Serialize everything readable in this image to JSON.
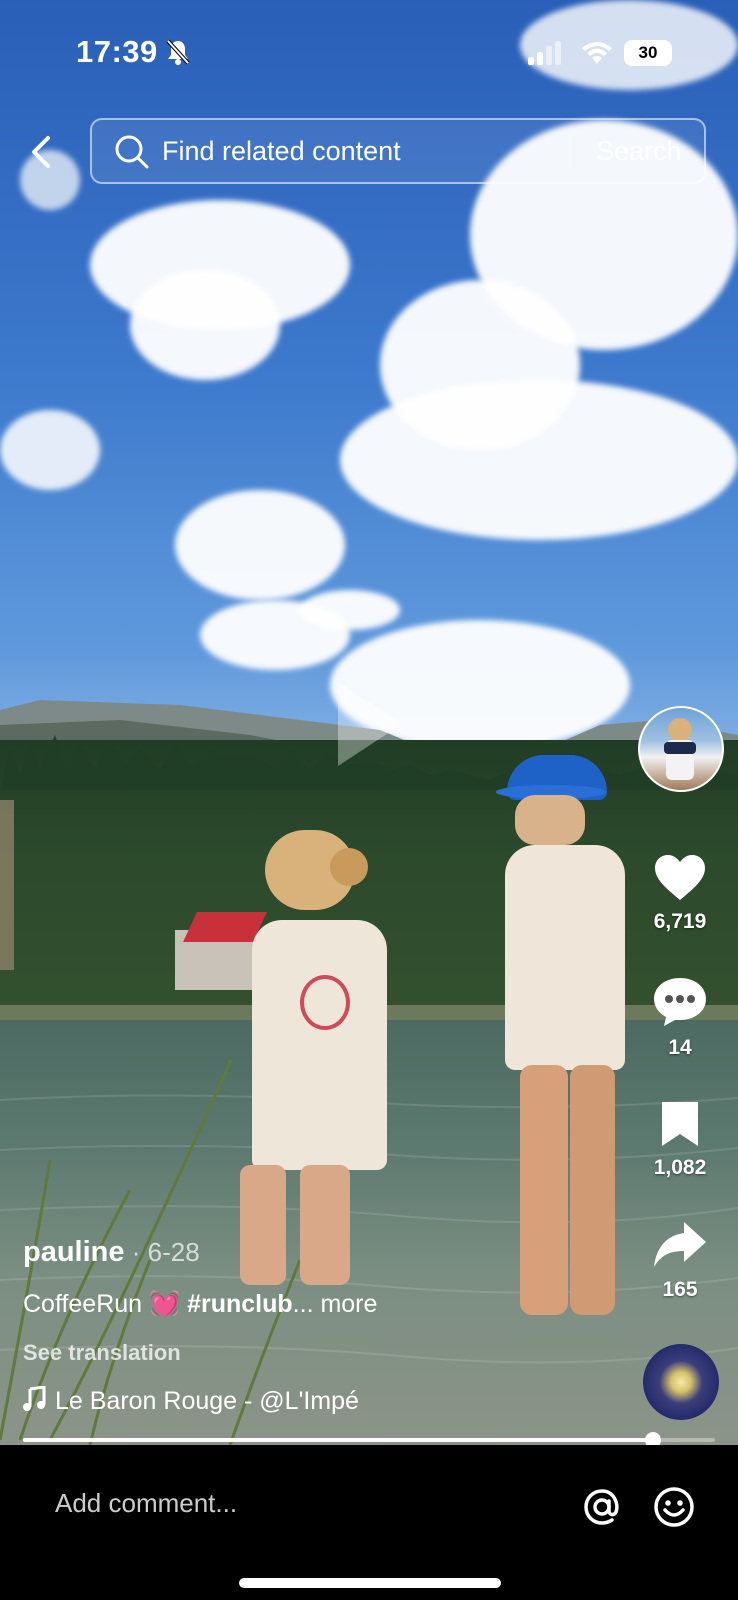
{
  "status_bar": {
    "time": "17:39",
    "battery": "30"
  },
  "search": {
    "placeholder": "Find related content",
    "button": "Search"
  },
  "actions": {
    "likes": "6,719",
    "comments": "14",
    "saves": "1,082",
    "shares": "165"
  },
  "post": {
    "username": "pauline",
    "date": " · 6-28",
    "description_text": "CoffeeRun ",
    "description_emoji": "💓",
    "description_tag": " #runclub",
    "description_more": "... more",
    "see_translation": "See translation",
    "music": "Le Baron Rouge - @L'Impé"
  },
  "progress": {
    "value": 0.91
  },
  "comment": {
    "placeholder": "Add comment..."
  },
  "icons": [
    "back-icon",
    "search-icon",
    "play-icon",
    "heart-icon",
    "comment-icon",
    "bookmark-icon",
    "share-icon",
    "music-note-icon",
    "at-icon",
    "emoji-icon",
    "bell-slash-icon",
    "signal-icon",
    "wifi-icon"
  ]
}
